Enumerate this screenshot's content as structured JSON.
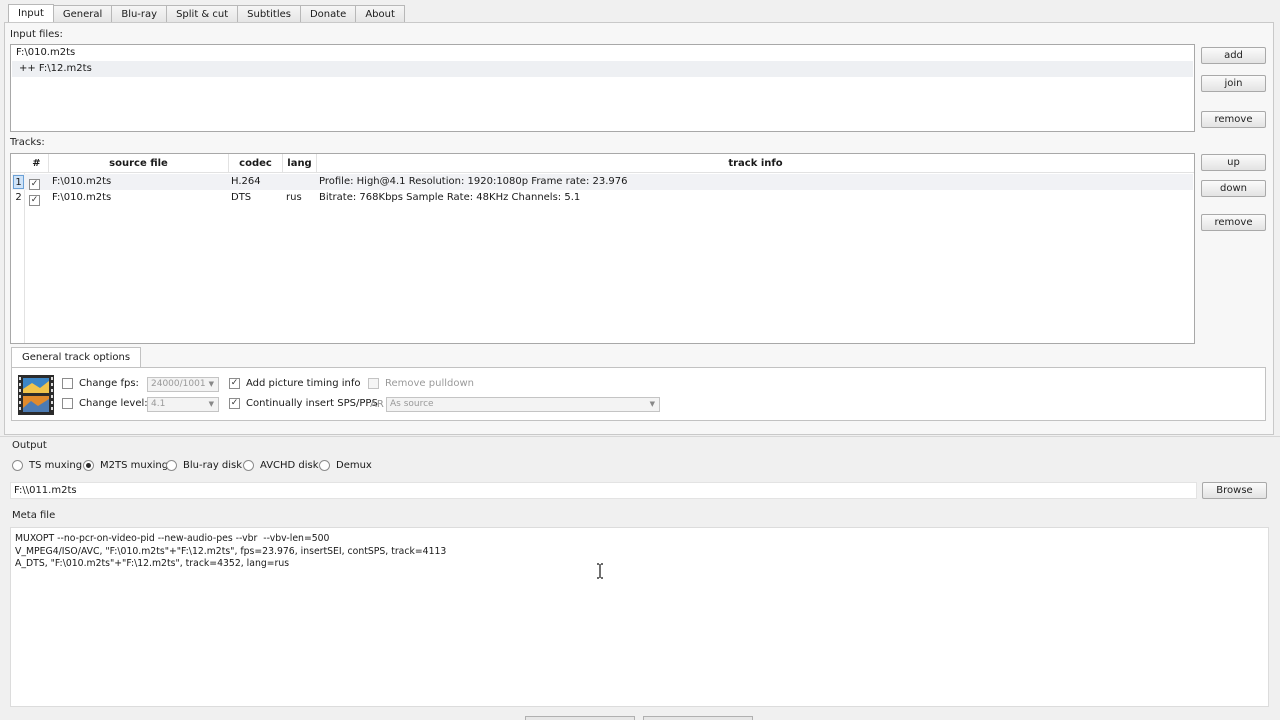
{
  "tabs": [
    "Input",
    "General",
    "Blu-ray",
    "Split & cut",
    "Subtitles",
    "Donate",
    "About"
  ],
  "input_files": {
    "label": "Input files:",
    "items": [
      "F:\\010.m2ts",
      "++ F:\\12.m2ts"
    ],
    "buttons": {
      "add": "add",
      "join": "join",
      "remove": "remove"
    }
  },
  "tracks": {
    "label": "Tracks:",
    "headers": {
      "num": "#",
      "source": "source file",
      "codec": "codec",
      "lang": "lang",
      "info": "track info"
    },
    "rows": [
      {
        "num": "1",
        "checked": true,
        "source": "F:\\010.m2ts",
        "codec": "H.264",
        "lang": "",
        "info": "Profile: High@4.1  Resolution: 1920:1080p  Frame rate: 23.976"
      },
      {
        "num": "2",
        "checked": true,
        "source": "F:\\010.m2ts",
        "codec": "DTS",
        "lang": "rus",
        "info": "Bitrate: 768Kbps  Sample Rate: 48KHz  Channels: 5.1"
      }
    ],
    "buttons": {
      "up": "up",
      "down": "down",
      "remove": "remove"
    }
  },
  "general_track_options": {
    "tab_label": "General track options",
    "change_fps": {
      "label": "Change fps:",
      "checked": false,
      "value": "24000/1001"
    },
    "change_level": {
      "label": "Change level:",
      "checked": false,
      "value": "4.1"
    },
    "add_picture_timing": {
      "label": "Add picture timing info",
      "checked": true
    },
    "continually_insert": {
      "label": "Continually insert SPS/PPS",
      "checked": true
    },
    "remove_pulldown": {
      "label": "Remove pulldown",
      "checked": false
    },
    "ar": {
      "label": "AR",
      "value": "As source"
    }
  },
  "output": {
    "label": "Output",
    "modes": [
      "TS muxing",
      "M2TS muxing",
      "Blu-ray disk",
      "AVCHD disk",
      "Demux"
    ],
    "selected_mode": "M2TS muxing",
    "path": "F:\\\\011.m2ts",
    "browse": "Browse"
  },
  "meta_file": {
    "label": "Meta file",
    "lines": [
      "MUXOPT --no-pcr-on-video-pid --new-audio-pes --vbr  --vbv-len=500",
      "V_MPEG4/ISO/AVC, \"F:\\010.m2ts\"+\"F:\\12.m2ts\", fps=23.976, insertSEI, contSPS, track=4113",
      "A_DTS, \"F:\\010.m2ts\"+\"F:\\12.m2ts\", track=4352, lang=rus"
    ]
  },
  "colors": {
    "window_bg": "#f0f0f0",
    "panel_border": "#a8a8a8",
    "selected_row": "#eef0f3",
    "selected_num": "#cfe3f8"
  },
  "icons": [
    "film-strip-icon",
    "checkbox-checked-icon",
    "combo-arrow-icon",
    "text-cursor-icon"
  ]
}
